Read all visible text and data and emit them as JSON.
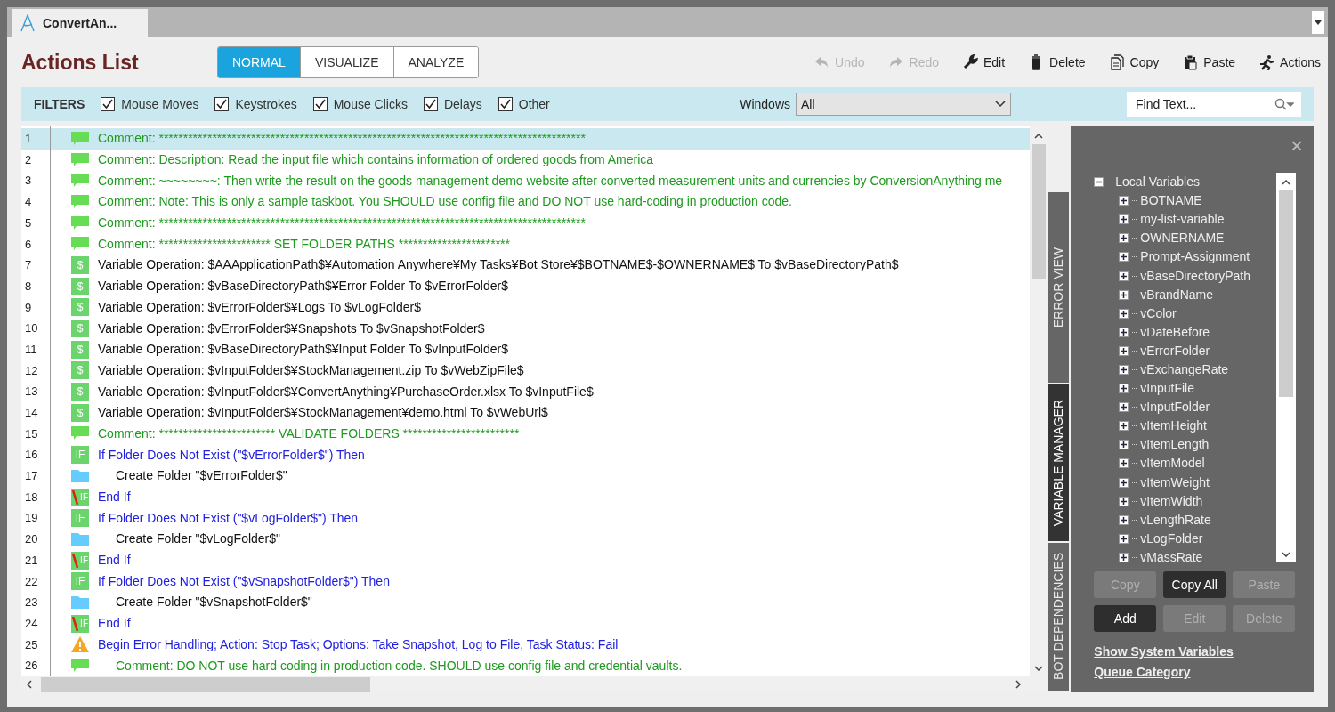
{
  "document_tab": {
    "title": "ConvertAn..."
  },
  "header": {
    "title": "Actions List",
    "modes": [
      {
        "label": "NORMAL",
        "selected": true
      },
      {
        "label": "VISUALIZE",
        "selected": false
      },
      {
        "label": "ANALYZE",
        "selected": false
      }
    ],
    "toolbar": [
      {
        "kind": "undo",
        "label": "Undo",
        "disabled": true
      },
      {
        "kind": "redo",
        "label": "Redo",
        "disabled": true
      },
      {
        "kind": "edit",
        "label": "Edit",
        "disabled": false
      },
      {
        "kind": "delete",
        "label": "Delete",
        "disabled": false
      },
      {
        "kind": "copy",
        "label": "Copy",
        "disabled": false
      },
      {
        "kind": "paste",
        "label": "Paste",
        "disabled": false
      },
      {
        "kind": "actions",
        "label": "Actions",
        "disabled": false
      }
    ]
  },
  "filters": {
    "label": "FILTERS",
    "options": [
      {
        "label": "Mouse Moves",
        "checked": true
      },
      {
        "label": "Keystrokes",
        "checked": true
      },
      {
        "label": "Mouse Clicks",
        "checked": true
      },
      {
        "label": "Delays",
        "checked": true
      },
      {
        "label": "Other",
        "checked": true
      }
    ],
    "windows_label": "Windows",
    "windows_value": "All",
    "find_placeholder": "Find Text..."
  },
  "actions": [
    {
      "number": "1",
      "kind": "comment",
      "text": "Comment: ****************************************************************************************",
      "selected": true
    },
    {
      "number": "2",
      "kind": "comment",
      "text": "Comment: Description: Read the input file which contains information of ordered goods from America",
      "selected": false
    },
    {
      "number": "3",
      "kind": "comment",
      "text": "Comment: ~~~~~~~~: Then write the result on the goods management demo website after converted measurement units and currencies by ConversionAnything me",
      "selected": false
    },
    {
      "number": "4",
      "kind": "comment",
      "text": "Comment: Note: This is only a sample taskbot. You SHOULD use config file and DO NOT use hard-coding in production code.",
      "selected": false
    },
    {
      "number": "5",
      "kind": "comment",
      "text": "Comment: ****************************************************************************************",
      "selected": false
    },
    {
      "number": "6",
      "kind": "comment",
      "text": "Comment: *********************** SET FOLDER PATHS ***********************",
      "selected": false
    },
    {
      "number": "7",
      "kind": "variable",
      "badge": "$",
      "text": "Variable Operation: $AAApplicationPath$¥Automation Anywhere¥My Tasks¥Bot Store¥$BOTNAME$-$OWNERNAME$ To $vBaseDirectoryPath$",
      "selected": false
    },
    {
      "number": "8",
      "kind": "variable",
      "badge": "$",
      "text": "Variable Operation: $vBaseDirectoryPath$¥Error Folder To $vErrorFolder$",
      "selected": false
    },
    {
      "number": "9",
      "kind": "variable",
      "badge": "$",
      "text": "Variable Operation: $vErrorFolder$¥Logs To $vLogFolder$",
      "selected": false
    },
    {
      "number": "10",
      "kind": "variable",
      "badge": "$",
      "text": "Variable Operation: $vErrorFolder$¥Snapshots To $vSnapshotFolder$",
      "selected": false
    },
    {
      "number": "11",
      "kind": "variable",
      "badge": "$",
      "text": "Variable Operation: $vBaseDirectoryPath$¥Input Folder To $vInputFolder$",
      "selected": false
    },
    {
      "number": "12",
      "kind": "variable",
      "badge": "$",
      "text": "Variable Operation: $vInputFolder$¥StockManagement.zip To $vWebZipFile$",
      "selected": false
    },
    {
      "number": "13",
      "kind": "variable",
      "badge": "$",
      "text": "Variable Operation: $vInputFolder$¥ConvertAnything¥PurchaseOrder.xlsx To $vInputFile$",
      "selected": false
    },
    {
      "number": "14",
      "kind": "variable",
      "badge": "$",
      "text": "Variable Operation: $vInputFolder$¥StockManagement¥demo.html To $vWebUrl$",
      "selected": false
    },
    {
      "number": "15",
      "kind": "comment",
      "text": "Comment: ************************ VALIDATE FOLDERS ************************",
      "selected": false
    },
    {
      "number": "16",
      "kind": "if",
      "badge": "IF",
      "text": "If Folder Does Not Exist (\"$vErrorFolder$\")  Then",
      "selected": false,
      "children": [
        {
          "number": "17",
          "kind": "folder",
          "text": "Create Folder \"$vErrorFolder$\"",
          "selected": false
        }
      ]
    },
    {
      "number": "18",
      "kind": "end_if",
      "badge": "IF",
      "text": "End If",
      "selected": false
    },
    {
      "number": "19",
      "kind": "if",
      "badge": "IF",
      "text": "If Folder Does Not Exist (\"$vLogFolder$\")  Then",
      "selected": false,
      "children": [
        {
          "number": "20",
          "kind": "folder",
          "text": "Create Folder \"$vLogFolder$\"",
          "selected": false
        }
      ]
    },
    {
      "number": "21",
      "kind": "end_if",
      "badge": "IF",
      "text": "End If",
      "selected": false
    },
    {
      "number": "22",
      "kind": "if",
      "badge": "IF",
      "text": "If Folder Does Not Exist (\"$vSnapshotFolder$\")  Then",
      "selected": false,
      "children": [
        {
          "number": "23",
          "kind": "folder",
          "text": "Create Folder \"$vSnapshotFolder$\"",
          "selected": false
        }
      ]
    },
    {
      "number": "24",
      "kind": "end_if",
      "badge": "IF",
      "text": "End If",
      "selected": false
    },
    {
      "number": "25",
      "kind": "error",
      "text": "Begin Error Handling; Action: Stop Task; Options: Take Snapshot, Log to File,  Task Status: Fail",
      "selected": false,
      "children": [
        {
          "number": "26",
          "kind": "comment",
          "text": "Comment: DO NOT use hard coding in production code. SHOULD use config file and credential vaults.",
          "selected": false
        }
      ]
    }
  ],
  "side_tabs": [
    {
      "label": "ERROR VIEW",
      "selected": false
    },
    {
      "label": "VARIABLE MANAGER",
      "selected": true
    },
    {
      "label": "BOT DEPENDENCIES",
      "selected": false
    }
  ],
  "variable_manager": {
    "close": "×",
    "tree": {
      "label": "Local Variables",
      "expanded": true,
      "children": [
        {
          "label": "BOTNAME",
          "expanded": false
        },
        {
          "label": "my-list-variable",
          "expanded": false
        },
        {
          "label": "OWNERNAME",
          "expanded": false
        },
        {
          "label": "Prompt-Assignment",
          "expanded": false
        },
        {
          "label": "vBaseDirectoryPath",
          "expanded": false
        },
        {
          "label": "vBrandName",
          "expanded": false
        },
        {
          "label": "vColor",
          "expanded": false
        },
        {
          "label": "vDateBefore",
          "expanded": false
        },
        {
          "label": "vErrorFolder",
          "expanded": false
        },
        {
          "label": "vExchangeRate",
          "expanded": false
        },
        {
          "label": "vInputFile",
          "expanded": false
        },
        {
          "label": "vInputFolder",
          "expanded": false
        },
        {
          "label": "vItemHeight",
          "expanded": false
        },
        {
          "label": "vItemLength",
          "expanded": false
        },
        {
          "label": "vItemModel",
          "expanded": false
        },
        {
          "label": "vItemWeight",
          "expanded": false
        },
        {
          "label": "vItemWidth",
          "expanded": false
        },
        {
          "label": "vLengthRate",
          "expanded": false
        },
        {
          "label": "vLogFolder",
          "expanded": false
        },
        {
          "label": "vMassRate",
          "expanded": false
        }
      ]
    },
    "buttons": [
      {
        "label": "Copy",
        "disabled": true
      },
      {
        "label": "Copy All",
        "disabled": false
      },
      {
        "label": "Paste",
        "disabled": true
      },
      {
        "label": "Add",
        "disabled": false
      },
      {
        "label": "Edit",
        "disabled": true
      },
      {
        "label": "Delete",
        "disabled": true
      }
    ],
    "links": [
      "Show System Variables",
      "Queue Category"
    ]
  }
}
